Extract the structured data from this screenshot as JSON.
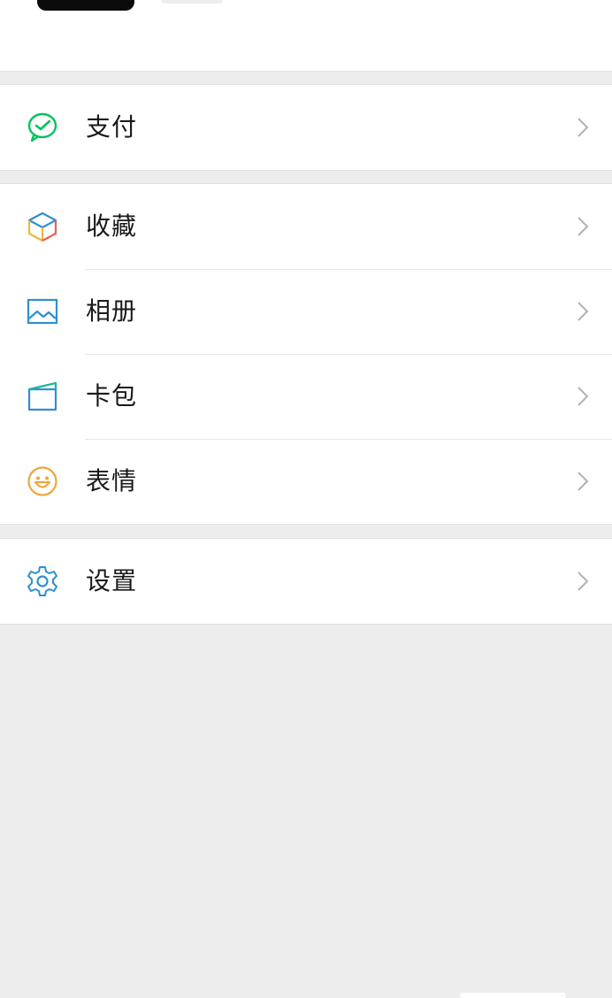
{
  "menu": {
    "pay": {
      "label": "支付",
      "icon": "wechat-pay-icon"
    },
    "favorites": {
      "label": "收藏",
      "icon": "cube-icon"
    },
    "album": {
      "label": "相册",
      "icon": "image-icon"
    },
    "cards": {
      "label": "卡包",
      "icon": "card-wallet-icon"
    },
    "stickers": {
      "label": "表情",
      "icon": "smiley-icon"
    },
    "settings": {
      "label": "设置",
      "icon": "gear-icon"
    }
  },
  "colors": {
    "background": "#ededed",
    "pay_green": "#07c160",
    "blue": "#2f8fd0",
    "sticker_orange": "#f0a53c"
  }
}
